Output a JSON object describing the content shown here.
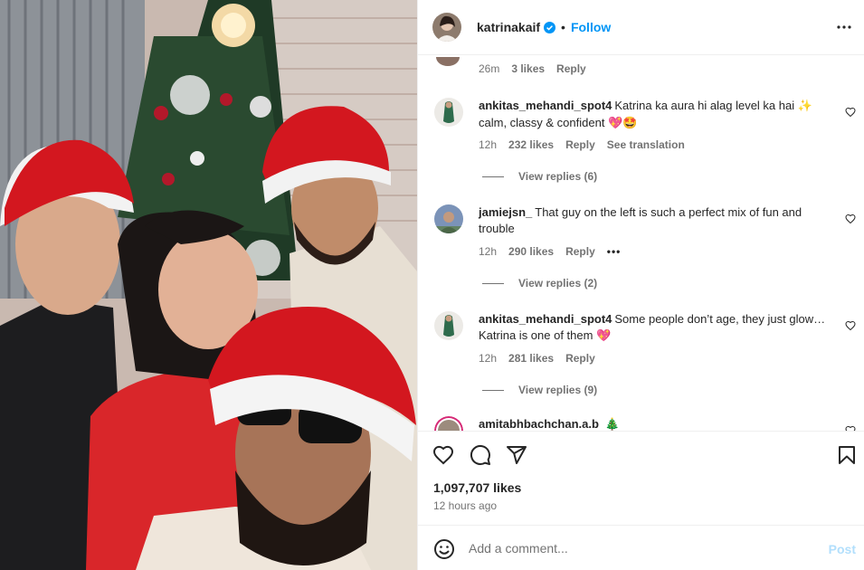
{
  "post": {
    "username": "katrinakaif",
    "verified": true,
    "separator": "•",
    "follow_label": "Follow",
    "more_icon": "more-horizontal-icon",
    "likes": "1,097,707 likes",
    "time": "12 hours ago"
  },
  "partial_comment": {
    "time": "26m",
    "likes": "3 likes",
    "reply": "Reply"
  },
  "comments": [
    {
      "username": "ankitas_mehandi_spot4",
      "text": "Katrina ka aura hi alag level ka hai",
      "text2": "calm, classy & confident",
      "emoji1": "✨",
      "emoji2": "💖🤩",
      "time": "12h",
      "likes": "232 likes",
      "reply": "Reply",
      "translation": "See translation",
      "view_replies": "View replies (6)"
    },
    {
      "username": "jamiejsn_",
      "text": "That guy on the left is such a perfect mix of fun and trouble",
      "time": "12h",
      "likes": "290 likes",
      "reply": "Reply",
      "ellipsis": "•••",
      "view_replies": "View replies (2)"
    },
    {
      "username": "ankitas_mehandi_spot4",
      "text": "Some people don’t age, they just glow… Katrina is one of them",
      "emoji": "💖",
      "time": "12h",
      "likes": "281 likes",
      "reply": "Reply",
      "view_replies": "View replies (9)"
    },
    {
      "username": "amitabhbachchan.a.b",
      "emoji": "🎄"
    }
  ],
  "actions": {
    "like_icon": "heart-icon",
    "comment_icon": "comment-icon",
    "share_icon": "share-icon",
    "save_icon": "bookmark-icon"
  },
  "add_comment": {
    "placeholder": "Add a comment...",
    "post_label": "Post"
  },
  "colors": {
    "accent": "#0095f6",
    "post_disabled": "#b2dffc",
    "secondary_text": "#737373"
  }
}
